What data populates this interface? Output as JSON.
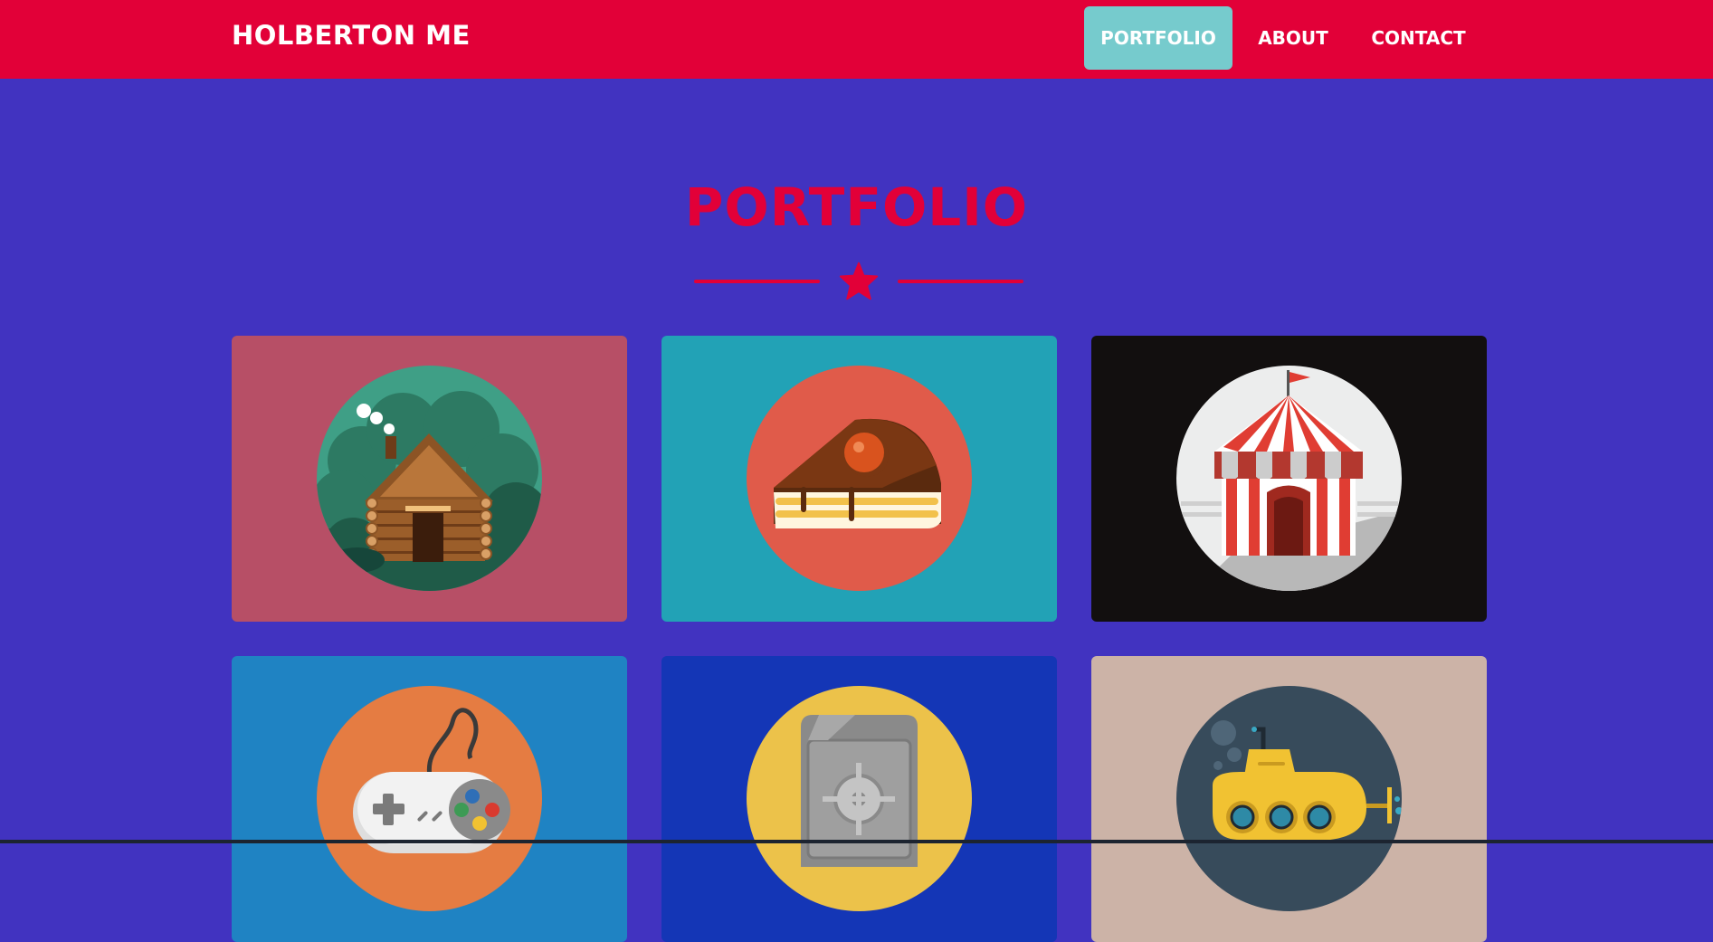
{
  "navbar": {
    "brand": "HOLBERTON ME",
    "links": [
      {
        "label": "PORTFOLIO",
        "active": true
      },
      {
        "label": "ABOUT",
        "active": false
      },
      {
        "label": "CONTACT",
        "active": false
      }
    ],
    "background": "#e20038",
    "active_color": "#76cbcd"
  },
  "portfolio": {
    "title": "PORTFOLIO",
    "divider_icon": "star-icon",
    "accent": "#e20038",
    "items": [
      {
        "icon": "log-cabin-icon",
        "background": "#b74f66",
        "circle": "#3f9f86"
      },
      {
        "icon": "cake-slice-icon",
        "background": "#22a2b6",
        "circle": "#e05b4a"
      },
      {
        "icon": "circus-tent-icon",
        "background": "#120f0f",
        "circle": "#eceded"
      },
      {
        "icon": "game-controller-icon",
        "background": "#1f83c3",
        "circle": "#e57c42"
      },
      {
        "icon": "safe-icon",
        "background": "#1436b6",
        "circle": "#ecc24a"
      },
      {
        "icon": "submarine-icon",
        "background": "#ccb3a7",
        "circle": "#374b5b"
      }
    ]
  },
  "page_background": "#4133c0"
}
